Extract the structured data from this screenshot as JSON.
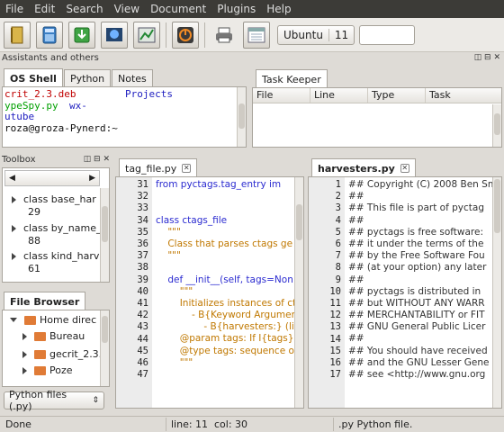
{
  "menu": [
    "File",
    "Edit",
    "Search",
    "View",
    "Document",
    "Plugins",
    "Help"
  ],
  "toolbar": {
    "icons": [
      "notebook-icon",
      "calculator-icon",
      "download-icon",
      "globe-icon",
      "chart-icon",
      "power-icon",
      "printer-icon",
      "calendar-icon"
    ],
    "combo_label": "Ubuntu",
    "combo_number": "11",
    "number_field_value": ""
  },
  "assistants_title": "Assistants and others",
  "shell": {
    "tabs": [
      "OS Shell",
      "Python",
      "Notes"
    ],
    "lines": [
      {
        "a": "crit_2.3.deb",
        "b": "Projects"
      },
      {
        "a": "ypeSpy.py",
        "b": "wx-"
      },
      {
        "a": "utube",
        "b": ""
      },
      {
        "a": "roza@groza-Pynerd:~",
        "b": ""
      }
    ]
  },
  "task_keeper": {
    "tab": "Task Keeper",
    "columns": [
      "File",
      "Line",
      "Type",
      "Task"
    ]
  },
  "toolbox": {
    "title": "Toolbox",
    "items": [
      {
        "name": "class base_har",
        "line": "29"
      },
      {
        "name": "class by_name_",
        "line": "88"
      },
      {
        "name": "class kind_harv",
        "line": "61"
      }
    ]
  },
  "file_browser": {
    "tab": "File Browser",
    "items": [
      "Home direc",
      "Bureau",
      "gecrit_2.3.",
      "Poze"
    ],
    "filter": "Python files (.py)"
  },
  "editor_left": {
    "tab": "tag_file.py",
    "line_numbers": [
      "31",
      "32",
      "33",
      "34",
      "35",
      "36",
      "37",
      "38",
      "39",
      "40",
      "41",
      "42",
      "43",
      "44",
      "45",
      "46",
      "47"
    ],
    "lines": [
      "from pyctags.tag_entry im",
      "",
      "",
      "class ctags_file",
      "    \"\"\"",
      "    Class that parses ctags ge",
      "    \"\"\"",
      "",
      "    def __init__(self, tags=Non",
      "        \"\"\"",
      "        Initializes instances of ct",
      "            - B{Keyword Argument",
      "                - B{harvesters:} (list) l",
      "        @param tags: If I{tags} is",
      "        @type tags: sequence or",
      "        \"\"\"",
      ""
    ]
  },
  "editor_right": {
    "tab": "harvesters.py",
    "line_numbers": [
      "1",
      "2",
      "3",
      "4",
      "5",
      "6",
      "7",
      "8",
      "9",
      "10",
      "11",
      "12",
      "13",
      "14",
      "15",
      "16",
      "17"
    ],
    "lines": [
      "## Copyright (C) 2008 Ben Sm",
      "##",
      "## This file is part of pyctag",
      "##",
      "## pyctags is free software:",
      "## it under the terms of the",
      "## by the Free Software Fou",
      "## (at your option) any later",
      "##",
      "## pyctags is distributed in",
      "## but WITHOUT ANY WARR",
      "## MERCHANTABILITY or FIT",
      "## GNU General Public Licer",
      "##",
      "## You should have received",
      "## and the GNU Lesser Gene",
      "## see <http://www.gnu.org"
    ]
  },
  "status": {
    "message": "Done",
    "line": "line: 11",
    "col": "col: 30",
    "filetype": ".py Python file."
  },
  "colors": {
    "keyword": "#2b2bd0",
    "docstring": "#c07800",
    "shell_file": "#c00000",
    "shell_py": "#00a000",
    "shell_dir": "#2020c0"
  }
}
